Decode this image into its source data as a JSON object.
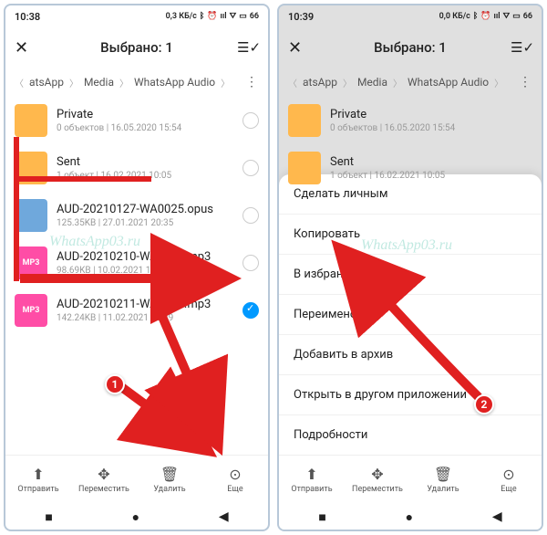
{
  "left": {
    "statusbar": {
      "time": "10:38",
      "net": "0,3 КБ/с",
      "battery": "66"
    },
    "appbar": {
      "title": "Выбрано: 1"
    },
    "breadcrumb": {
      "p1": "atsApp",
      "p2": "Media",
      "p3": "WhatsApp Audio"
    },
    "files": [
      {
        "name": "Private",
        "meta": "0 объектов | 16.05.2020 15:54",
        "type": "folder",
        "checked": false
      },
      {
        "name": "Sent",
        "meta": "1 объект | 16.02.2021 10:05",
        "type": "folder",
        "checked": false
      },
      {
        "name": "AUD-20210127-WA0025.opus",
        "meta": "125.35KB | 27.01.2021 20:35",
        "type": "opus",
        "checked": false
      },
      {
        "name": "AUD-20210210-WA0005.mp3",
        "meta": "98.69KB | 10.02.2021 10:02",
        "type": "mp3",
        "checked": false
      },
      {
        "name": "AUD-20210211-WA0016.mp3",
        "meta": "142.24KB | 11.02.2021 20:29",
        "type": "mp3",
        "checked": true
      }
    ],
    "bottombar": {
      "send": "Отправить",
      "move": "Переместить",
      "del": "Удалить",
      "more": "Еще"
    }
  },
  "right": {
    "statusbar": {
      "time": "10:39",
      "net": "0,0 КБ/с",
      "battery": "66"
    },
    "appbar": {
      "title": "Выбрано: 1"
    },
    "breadcrumb": {
      "p1": "atsApp",
      "p2": "Media",
      "p3": "WhatsApp Audio"
    },
    "files": [
      {
        "name": "Private",
        "meta": "0 объектов | 16.05.2020 15:54",
        "type": "folder"
      },
      {
        "name": "Sent",
        "meta": "1 объект | 16.02.2021 10:05",
        "type": "folder"
      }
    ],
    "sheet": [
      "Сделать личным",
      "Копировать",
      "В избранное",
      "Переименовать",
      "Добавить в архив",
      "Открыть в другом приложении",
      "Подробности"
    ],
    "bottombar": {
      "send": "Отправить",
      "move": "Переместить",
      "del": "Удалить",
      "more": "Еще"
    }
  },
  "icons": {
    "signal": "📶",
    "wifi": "📡",
    "bt": "ᛒ",
    "vib": "📳",
    "batt": "▭"
  },
  "watermark": "WhatsApp03.ru",
  "steps": {
    "s1": "1",
    "s2": "2"
  }
}
